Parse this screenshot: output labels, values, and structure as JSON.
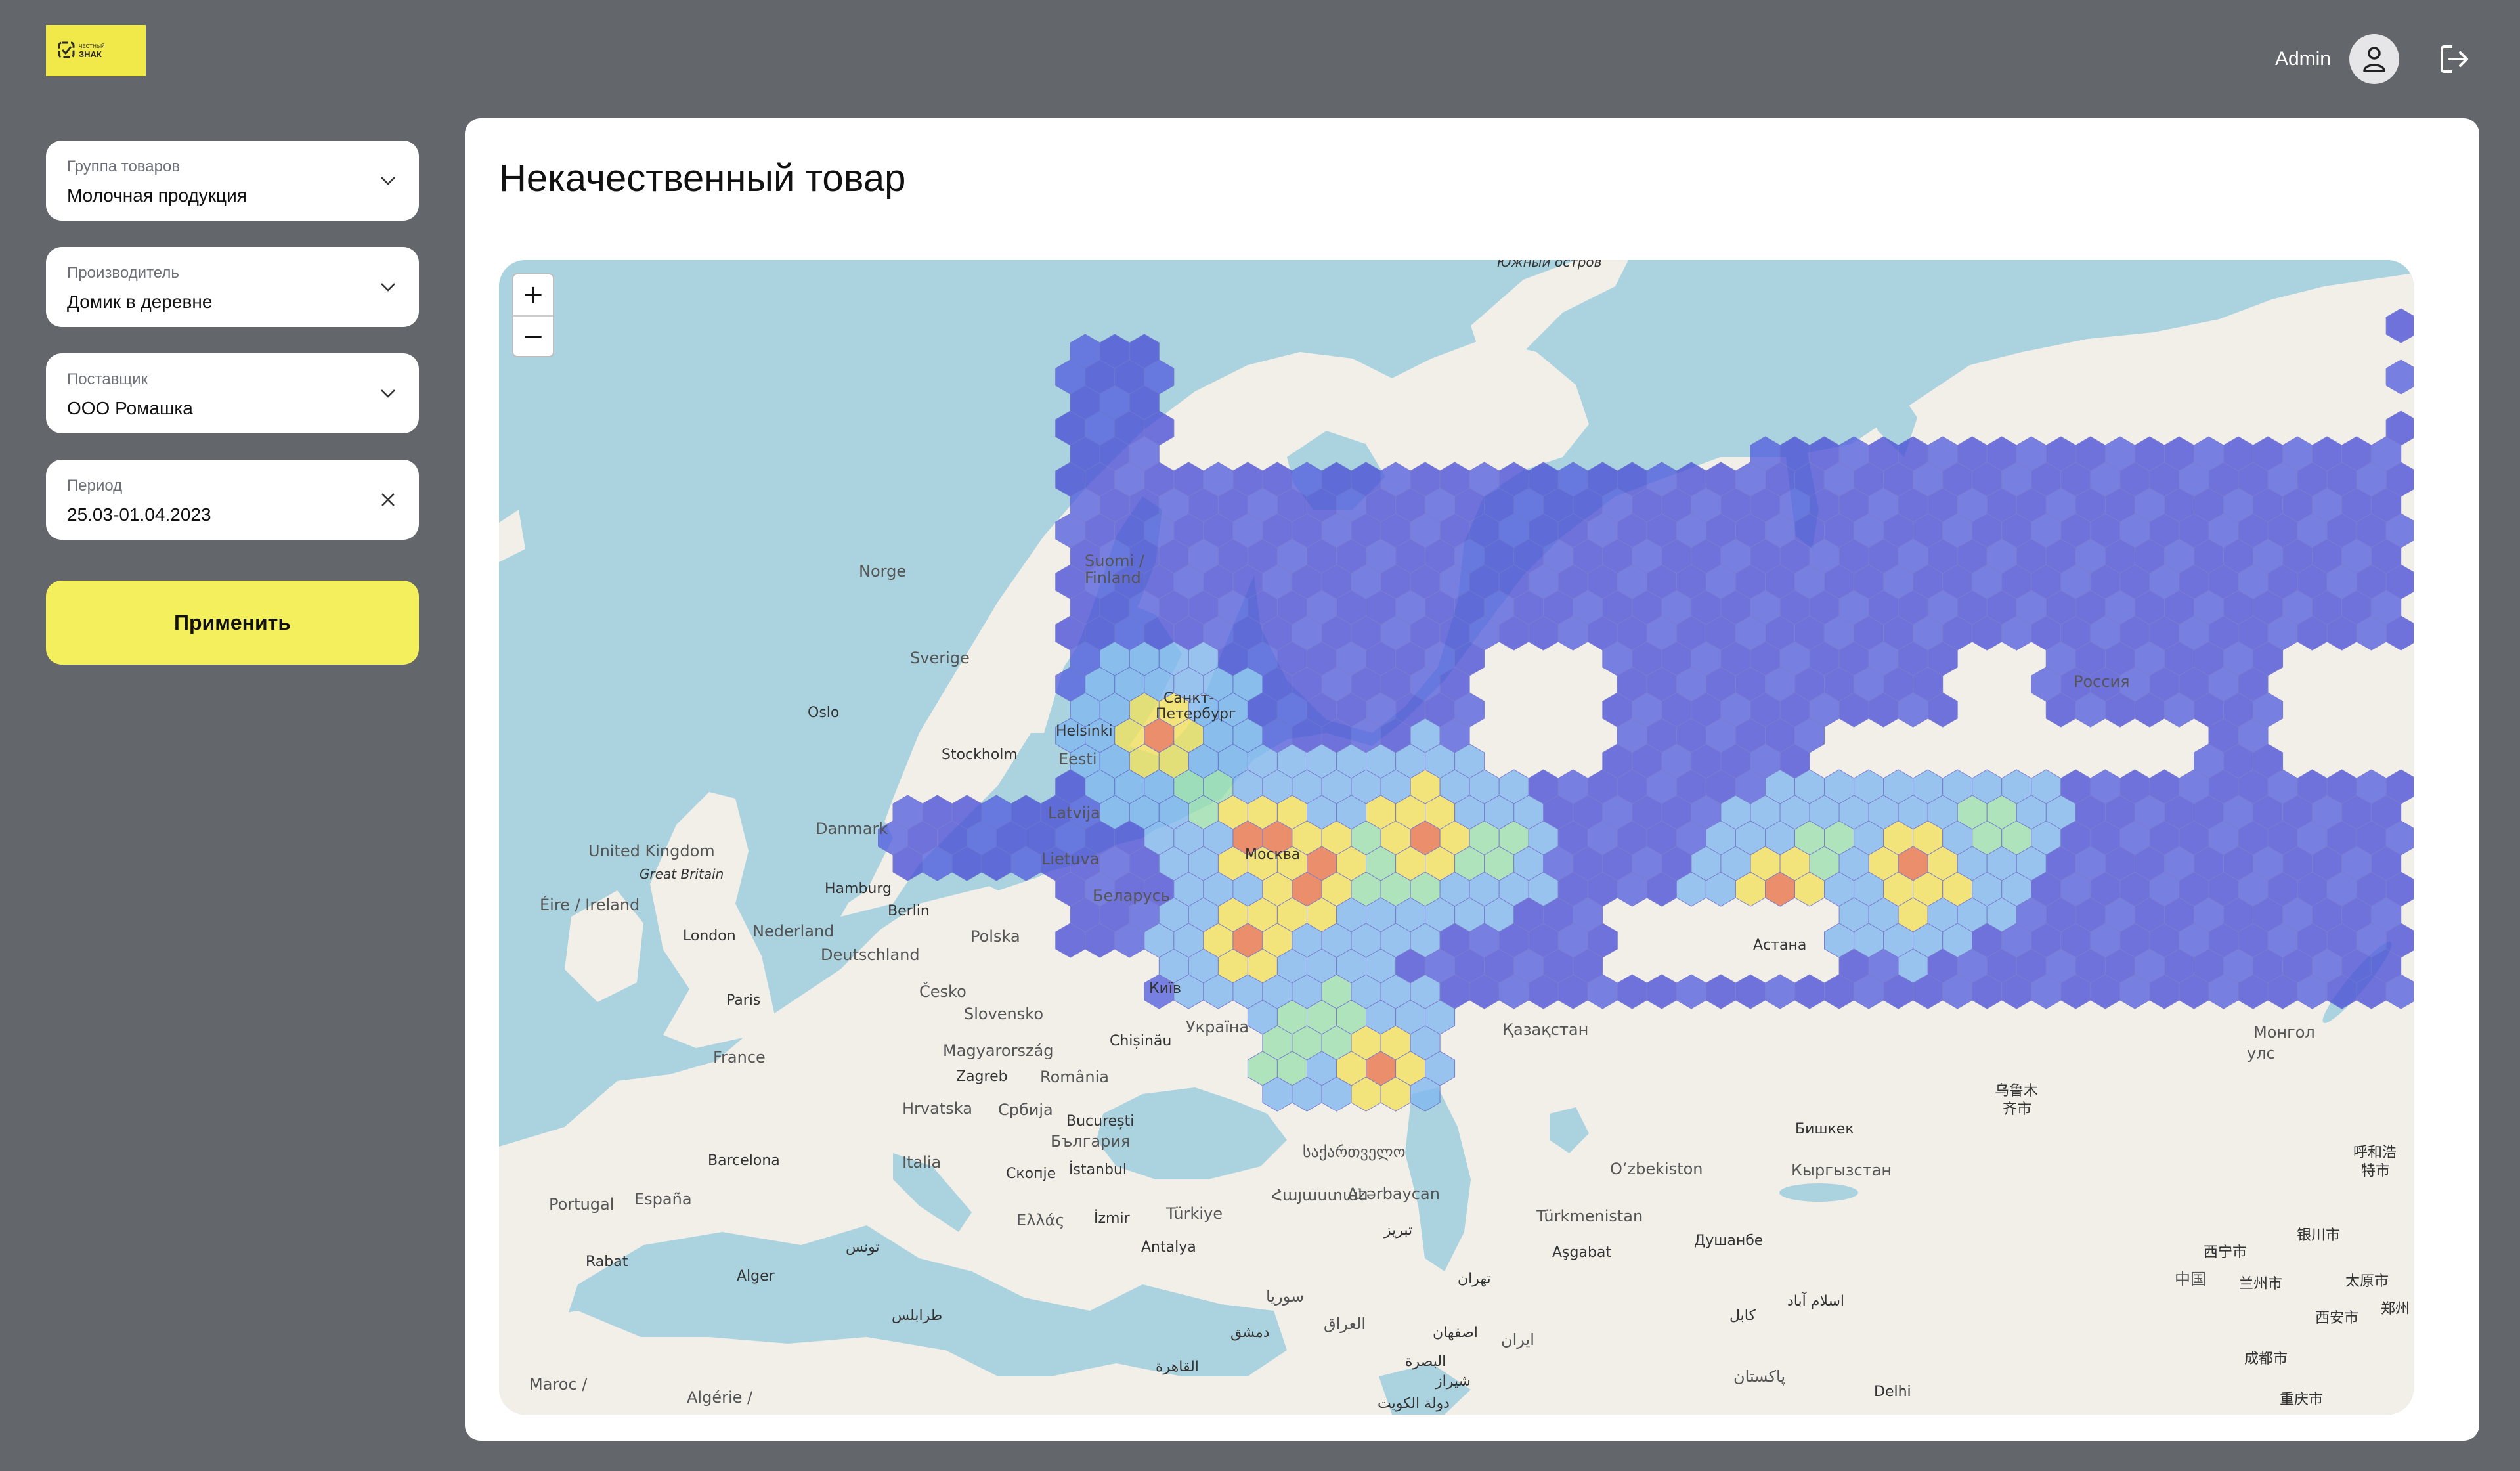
{
  "header": {
    "logo_text": "ЧЕСТНЫЙ ЗНАК",
    "user_name": "Admin"
  },
  "filters": [
    {
      "label": "Группа товаров",
      "value": "Молочная продукция",
      "icon": "chevron-down-icon"
    },
    {
      "label": "Производитель",
      "value": "Домик в деревне",
      "icon": "chevron-down-icon"
    },
    {
      "label": "Поставщик",
      "value": "ООО Ромашка",
      "icon": "chevron-down-icon"
    },
    {
      "label": "Период",
      "value": "25.03-01.04.2023",
      "icon": "close-icon"
    }
  ],
  "apply_label": "Применить",
  "main": {
    "title": "Некачественный товар"
  },
  "map": {
    "zoom_in": "+",
    "zoom_out": "−",
    "labels": {
      "island": "Южный остров",
      "island2": "",
      "norge": "Norge",
      "sverige": "Sverige",
      "suomi": "Suomi /",
      "finland": "Finland",
      "oslo": "Oslo",
      "stockholm": "Stockholm",
      "helsinki": "Helsinki",
      "eesti": "Eesti",
      "latvija": "Latvija",
      "lietuva": "Lietuva",
      "danmark": "Danmark",
      "spb1": "Санкт-",
      "spb2": "Петербург",
      "moskva": "Москва",
      "belarus": "Беларусь",
      "uk": "United Kingdom",
      "gb": "Great Britain",
      "eire": "Éire / Ireland",
      "london": "London",
      "hamburg": "Hamburg",
      "berlin": "Berlin",
      "nederland": "Nederland",
      "deutschland": "Deutschland",
      "polska": "Polska",
      "paris": "Paris",
      "france": "France",
      "cesko": "Česko",
      "slovensko": "Slovensko",
      "magyar": "Magyarország",
      "zagreb": "Zagreb",
      "hrvatska": "Hrvatska",
      "srbija": "Србија",
      "romania": "România",
      "bucuresti": "București",
      "bulgaria": "България",
      "kyiv": "Київ",
      "ukraina": "Україна",
      "chisinau": "Chișinău",
      "barcelona": "Barcelona",
      "espana": "España",
      "portugal": "Portugal",
      "italia": "Italia",
      "skopje": "Скопје",
      "istanbul": "İstanbul",
      "ellas": "Ελλάς",
      "izmir": "İzmir",
      "turkiye": "Türkiye",
      "antalya": "Antalya",
      "rabat": "Rabat",
      "alger": "Alger",
      "maroc": "Maroc /",
      "algerie": "Algérie /",
      "qazaqstan": "Қазақстан",
      "astana": "Астана",
      "rossiya": "Россия",
      "ozbekiston": "Oʻzbekiston",
      "bishkek": "Бишкек",
      "kyrgyzstan": "Кыргызстан",
      "turkmenistan": "Türkmenistan",
      "asgabat": "Aşgabat",
      "dushanbe": "Душанбе",
      "azerbaycan": "Azərbaycan",
      "georgia": "საქართველო",
      "armenia": "Հայաստան",
      "mongol": "Монгол",
      "ulaanbaatar": "улс",
      "urumqi1": "乌鲁木",
      "urumqi2": "齐市",
      "hohhot1": "呼和浩",
      "hohhot2": "特市",
      "china": "中国",
      "xining": "西宁市",
      "lanzhou": "兰州市",
      "yinchuan": "银川市",
      "taiyuan": "太原市",
      "xian": "西安市",
      "zhengzhou": "郑州",
      "chengdu": "成都市",
      "chongqing": "重庆市",
      "delhi": "Delhi",
      "pakistan": "پاکستان",
      "kabul": "کابل",
      "islamabad": "اسلام آباد",
      "iran": "ایران",
      "iraq": "العراق",
      "tehran": "تهران",
      "esfahan": "اصفهان",
      "shiraz": "شیراز",
      "kuwait": "دولة الكويت",
      "basra": "البصرة",
      "cairo": "القاهرة",
      "damascus": "دمشق",
      "syria": "سوريا",
      "tabriz": "تبریز",
      "tunis": "تونس",
      "libya": "طرابلس"
    }
  }
}
